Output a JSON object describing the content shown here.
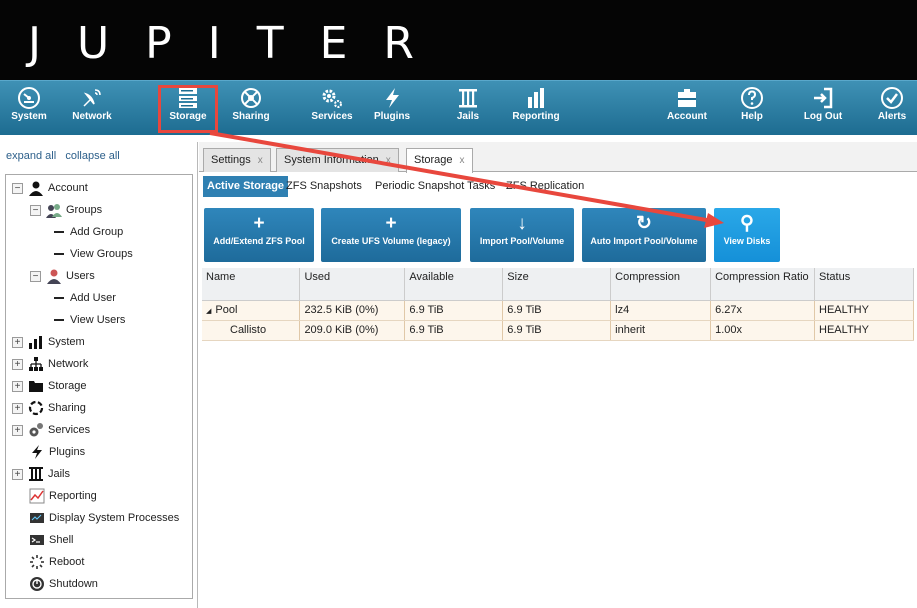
{
  "app": {
    "brand": "JUPITER"
  },
  "colors": {
    "brand_bar": "#050505",
    "nav_blue": "#2a7ca3",
    "accent": "#1590d8",
    "highlight": "#e8473d",
    "row_bg": "#fdf6ec"
  },
  "nav": {
    "items": [
      {
        "label": "System",
        "icon": "gauge-icon"
      },
      {
        "label": "Network",
        "icon": "satellite-icon"
      },
      {
        "label": "Storage",
        "icon": "server-rack-icon"
      },
      {
        "label": "Sharing",
        "icon": "share-icon"
      },
      {
        "label": "Services",
        "icon": "gears-icon"
      },
      {
        "label": "Plugins",
        "icon": "lightning-icon"
      },
      {
        "label": "Jails",
        "icon": "jail-bars-icon"
      },
      {
        "label": "Reporting",
        "icon": "bar-chart-icon"
      },
      {
        "label": "Account",
        "icon": "id-card-icon"
      },
      {
        "label": "Help",
        "icon": "question-icon"
      },
      {
        "label": "Log Out",
        "icon": "logout-icon"
      },
      {
        "label": "Alerts",
        "icon": "check-circle-icon"
      }
    ]
  },
  "sidebar": {
    "expand_all": "expand all",
    "collapse_all": "collapse all",
    "tree": {
      "account": "Account",
      "groups": "Groups",
      "add_group": "Add Group",
      "view_groups": "View Groups",
      "users": "Users",
      "add_user": "Add User",
      "view_users": "View Users",
      "system": "System",
      "network": "Network",
      "storage": "Storage",
      "sharing": "Sharing",
      "services": "Services",
      "plugins": "Plugins",
      "jails": "Jails",
      "reporting": "Reporting",
      "processes": "Display System Processes",
      "shell": "Shell",
      "reboot": "Reboot",
      "shutdown": "Shutdown"
    }
  },
  "tabs": [
    {
      "label": "Settings",
      "close": "x"
    },
    {
      "label": "System Information",
      "close": "x"
    },
    {
      "label": "Storage",
      "close": "x"
    }
  ],
  "subtabs": [
    "Active Storage",
    "ZFS Snapshots",
    "Periodic Snapshot Tasks",
    "ZFS Replication"
  ],
  "actions": [
    {
      "label": "Add/Extend ZFS Pool",
      "icon": "+"
    },
    {
      "label": "Create UFS Volume (legacy)",
      "icon": "+"
    },
    {
      "label": "Import Pool/Volume",
      "icon": "↓"
    },
    {
      "label": "Auto Import Pool/Volume",
      "icon": "↻"
    },
    {
      "label": "View Disks",
      "icon": "⚲"
    }
  ],
  "table": {
    "headers": [
      "Name",
      "Used",
      "Available",
      "Size",
      "Compression",
      "Compression Ratio",
      "Status"
    ],
    "rows": [
      {
        "name": "Pool",
        "expander": "◢",
        "used": "232.5 KiB (0%)",
        "available": "6.9 TiB",
        "size": "6.9 TiB",
        "compression": "lz4",
        "ratio": "6.27x",
        "status": "HEALTHY"
      },
      {
        "name": "Callisto",
        "expander": "",
        "used": "209.0 KiB (0%)",
        "available": "6.9 TiB",
        "size": "6.9 TiB",
        "compression": "inherit",
        "ratio": "1.00x",
        "status": "HEALTHY"
      }
    ]
  }
}
